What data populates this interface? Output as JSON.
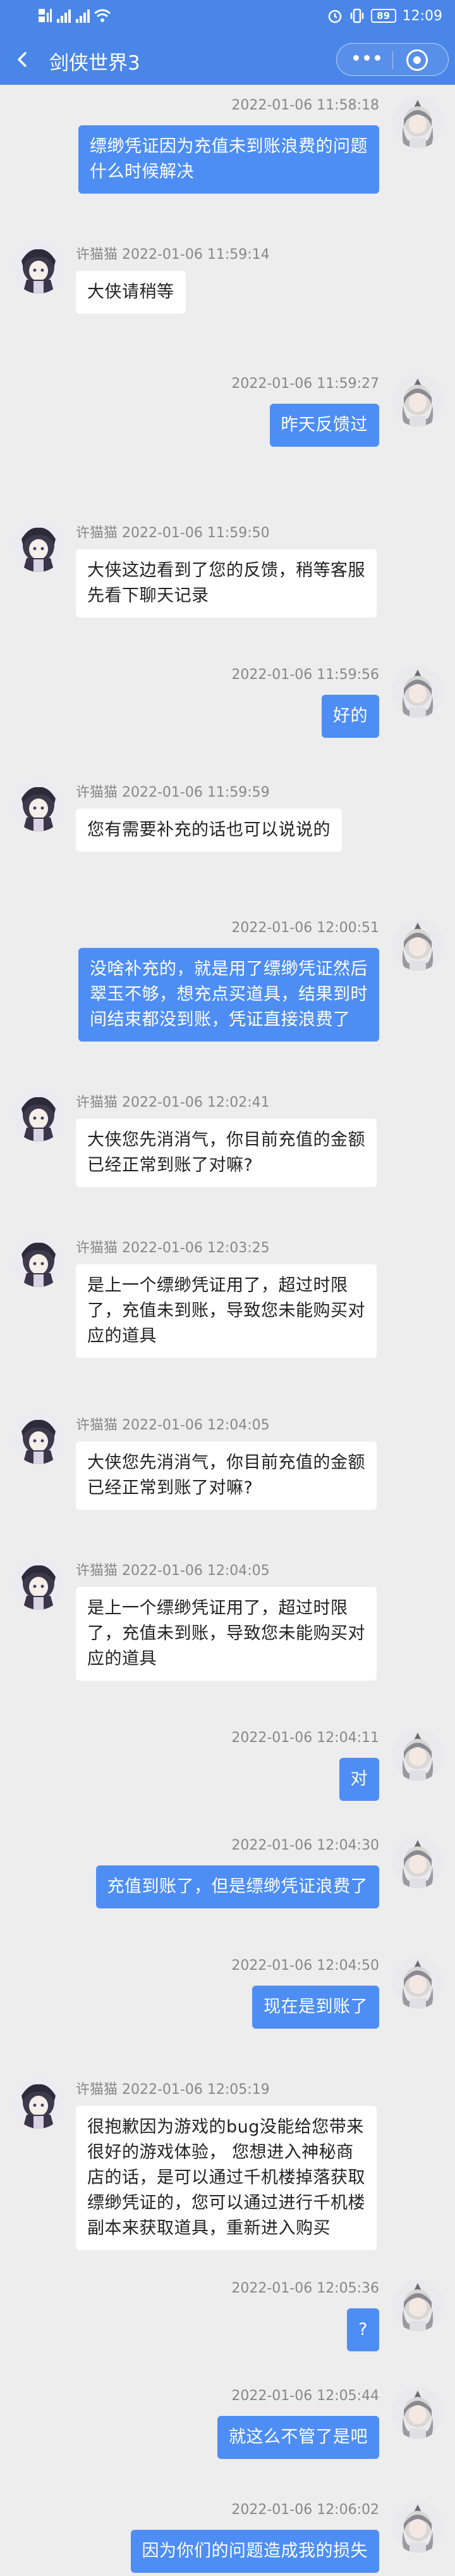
{
  "status_bar": {
    "left_icons": [
      "hd-signal-icon",
      "signal-icon",
      "signal-icon",
      "wifi-icon"
    ],
    "battery": "89",
    "time": "12:09"
  },
  "nav": {
    "title": "剑侠世界3"
  },
  "messages": [
    {
      "side": "out",
      "meta": "2022-01-06 11:58:18",
      "text": "缥缈凭证因为充值未到账浪费的问题\n什么时候解决"
    },
    {
      "side": "in",
      "meta": "许猫猫 2022-01-06 11:59:14",
      "text": "大侠请稍等"
    },
    {
      "side": "out",
      "meta": "2022-01-06 11:59:27",
      "text": "昨天反馈过"
    },
    {
      "side": "in",
      "meta": "许猫猫 2022-01-06 11:59:50",
      "text": "大侠这边看到了您的反馈，稍等客服\n先看下聊天记录"
    },
    {
      "side": "out",
      "meta": "2022-01-06 11:59:56",
      "text": "好的"
    },
    {
      "side": "in",
      "meta": "许猫猫 2022-01-06 11:59:59",
      "text": "您有需要补充的话也可以说说的"
    },
    {
      "side": "out",
      "meta": "2022-01-06 12:00:51",
      "text": "没啥补充的，就是用了缥缈凭证然后\n翠玉不够，想充点买道具，结果到时\n间结束都没到账，凭证直接浪费了"
    },
    {
      "side": "in",
      "meta": "许猫猫 2022-01-06 12:02:41",
      "text": "大侠您先消消气，你目前充值的金额\n已经正常到账了对嘛?"
    },
    {
      "side": "in",
      "meta": "许猫猫 2022-01-06 12:03:25",
      "text": "是上一个缥缈凭证用了，超过时限\n了，充值未到账，导致您未能购买对\n应的道具"
    },
    {
      "side": "in",
      "meta": "许猫猫 2022-01-06 12:04:05",
      "text": "大侠您先消消气，你目前充值的金额\n已经正常到账了对嘛?"
    },
    {
      "side": "in",
      "meta": "许猫猫 2022-01-06 12:04:05",
      "text": "是上一个缥缈凭证用了，超过时限\n了，充值未到账，导致您未能购买对\n应的道具"
    },
    {
      "side": "out",
      "meta": "2022-01-06 12:04:11",
      "text": "对"
    },
    {
      "side": "out",
      "meta": "2022-01-06 12:04:30",
      "text": "充值到账了，但是缥缈凭证浪费了"
    },
    {
      "side": "out",
      "meta": "2022-01-06 12:04:50",
      "text": "现在是到账了"
    },
    {
      "side": "in",
      "meta": "许猫猫 2022-01-06 12:05:19",
      "text": "很抱歉因为游戏的bug没能给您带来\n很好的游戏体验， 您想进入神秘商\n店的话，是可以通过千机楼掉落获取\n缥缈凭证的，您可以通过进行千机楼\n副本来获取道具，重新进入购买"
    },
    {
      "side": "out",
      "meta": "2022-01-06 12:05:36",
      "text": "?"
    },
    {
      "side": "out",
      "meta": "2022-01-06 12:05:44",
      "text": "就这么不管了是吧"
    },
    {
      "side": "out",
      "meta": "2022-01-06 12:06:02",
      "text": "因为你们的问题造成我的损失"
    }
  ]
}
